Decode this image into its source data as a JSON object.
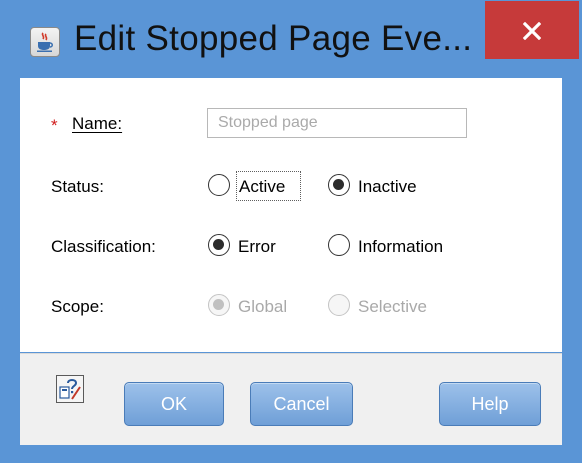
{
  "window": {
    "title": "Edit Stopped Page Eve...",
    "close_symbol": "✕"
  },
  "form": {
    "name": {
      "required_mark": "*",
      "label": "Name:",
      "value": "",
      "placeholder": "Stopped page"
    },
    "status": {
      "label": "Status:",
      "options": [
        {
          "label": "Active",
          "checked": false,
          "focused": true
        },
        {
          "label": "Inactive",
          "checked": true
        }
      ]
    },
    "classification": {
      "label": "Classification:",
      "options": [
        {
          "label": "Error",
          "checked": true
        },
        {
          "label": "Information",
          "checked": false
        }
      ]
    },
    "scope": {
      "label": "Scope:",
      "disabled": true,
      "options": [
        {
          "label": "Global",
          "checked": true
        },
        {
          "label": "Selective",
          "checked": false
        }
      ]
    }
  },
  "footer": {
    "ok_label": "OK",
    "cancel_label": "Cancel",
    "help_label": "Help"
  },
  "colors": {
    "frame": "#5a95d6",
    "close_button": "#c63a3a",
    "button_blue": "#7aa8dd",
    "required": "#d01b1b"
  }
}
